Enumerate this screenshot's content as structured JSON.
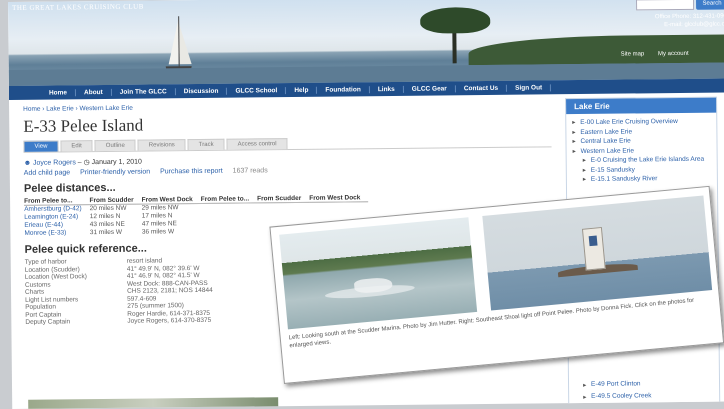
{
  "header": {
    "site_name": "THE GREAT LAKES CRUISING CLUB",
    "search_button": "Search",
    "office_phone": "Office Phone: 312-431-0904",
    "office_email": "E-mail: glcclub@glcc.org",
    "links": [
      "Site map",
      "My account"
    ]
  },
  "nav": [
    "Home",
    "About",
    "Join The GLCC",
    "Discussion",
    "GLCC School",
    "Help",
    "Foundation",
    "Links",
    "GLCC Gear",
    "Contact Us",
    "Sign Out"
  ],
  "breadcrumb": "Home › Lake Erie › Western Lake Erie",
  "page_title": "E-33 Pelee Island",
  "tabs": [
    "View",
    "Edit",
    "Outline",
    "Revisions",
    "Track",
    "Access control"
  ],
  "author": {
    "name": "Joyce Rogers",
    "date": "January 1, 2010"
  },
  "actions": {
    "add_child": "Add child page",
    "printer": "Printer-friendly version",
    "purchase": "Purchase this report",
    "reads": "1637 reads"
  },
  "distances": {
    "heading": "Pelee distances...",
    "columns": [
      "From Pelee to...",
      "From Scudder",
      "From West Dock",
      "From Pelee to...",
      "From Scudder",
      "From West Dock"
    ],
    "rows": [
      [
        "Amherstburg (D-42)",
        "20 miles NW",
        "29 miles NW",
        "",
        "",
        ""
      ],
      [
        "Leamington (E-24)",
        "12 miles N",
        "17 miles N",
        "",
        "",
        ""
      ],
      [
        "Erieau (E-44)",
        "43 miles NE",
        "47 miles NE",
        "",
        "",
        ""
      ],
      [
        "Monroe (E-33)",
        "31 miles W",
        "36 miles W",
        "",
        "",
        ""
      ]
    ]
  },
  "reference": {
    "heading": "Pelee quick reference...",
    "rows": [
      [
        "Type of harbor",
        "resort island"
      ],
      [
        "Location (Scudder)",
        "41° 49.9' N, 082° 39.6' W"
      ],
      [
        "Location (West Dock)",
        "41° 46.9' N, 082° 41.5' W"
      ],
      [
        "Customs",
        "West Dock: 888-CAN-PASS"
      ],
      [
        "Charts",
        "CHS 2123, 2181; NOS 14844"
      ],
      [
        "Light List numbers",
        "597.4-609"
      ],
      [
        "Population",
        "275 (summer 1500)"
      ],
      [
        "Port Captain",
        "Roger Hardie, 614-371-8375"
      ],
      [
        "Deputy Captain",
        "Joyce Rogers, 614-370-8375"
      ]
    ]
  },
  "sidebar": {
    "title": "Lake Erie",
    "items": [
      {
        "label": "E-00 Lake Erie Cruising Overview",
        "level": 0
      },
      {
        "label": "Eastern Lake Erie",
        "level": 0
      },
      {
        "label": "Central Lake Erie",
        "level": 0
      },
      {
        "label": "Western Lake Erie",
        "level": 0
      },
      {
        "label": "E-0 Cruising the Lake Erie Islands Area",
        "level": 1
      },
      {
        "label": "E-15 Sandusky",
        "level": 1
      },
      {
        "label": "E-15.1 Sandusky River",
        "level": 1
      }
    ],
    "bottom_items": [
      "E-49 Port Clinton",
      "E-49.5 Cooley Creek"
    ]
  },
  "overlay": {
    "caption": "Left: Looking south at the Scudder Marina. Photo by Jim Hutter. Right: Southeast Shoal light off Point Pelee. Photo by Donna Fick. Click on the photos for enlarged views."
  },
  "colors": {
    "brand_blue": "#1f4e8a",
    "accent_blue": "#3d7cc9",
    "link": "#2a5fa8"
  }
}
